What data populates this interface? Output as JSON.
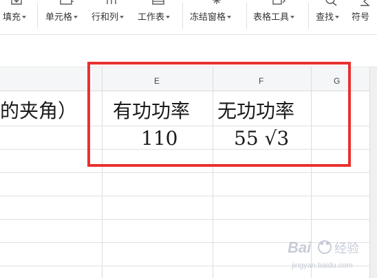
{
  "toolbar": {
    "fill_label": "填充",
    "cell_label": "单元格",
    "rowcol_label": "行和列",
    "sheet_label": "工作表",
    "freeze_label": "冻结窗格",
    "tabletools_label": "表格工具",
    "find_label": "查找",
    "symbol_label": "符号"
  },
  "columns": {
    "e": "E",
    "f": "F",
    "g": "G"
  },
  "cells": {
    "d_row1": "的夹角）",
    "e_row1": "有功功率",
    "f_row1": "无功功率",
    "e_row2": "110",
    "f_row2": "55 √3"
  },
  "watermark": {
    "brand": "Bai",
    "brand_suffix": "经验",
    "url": "jingyan.baidu.com"
  },
  "colors": {
    "highlight": "#e8312f",
    "header_bg": "#f5f6f7",
    "grid_line": "#dcdcdc"
  }
}
